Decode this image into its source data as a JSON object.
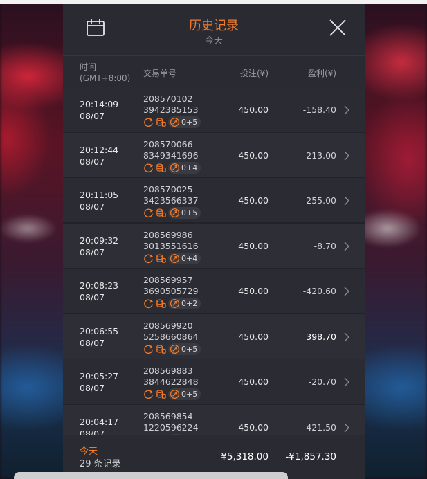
{
  "header": {
    "title": "历史记录",
    "subtitle": "今天",
    "calendar_icon": "calendar-icon",
    "close_icon": "close-icon"
  },
  "columns": {
    "time_line1": "时间",
    "time_line2": "(GMT+8:00)",
    "order": "交易单号",
    "stake": "投注(¥)",
    "profit": "盈利(¥)"
  },
  "colors": {
    "accent": "#f07a2a",
    "panel": "#26272e",
    "row": "#2b2c33",
    "text": "#cfd0d4"
  },
  "rows": [
    {
      "time": "20:14:09",
      "date": "08/07",
      "id1": "208570102",
      "id2": "3942385153",
      "combo": "0+5",
      "stake": "450.00",
      "profit": "-158.40"
    },
    {
      "time": "20:12:44",
      "date": "08/07",
      "id1": "208570066",
      "id2": "8349341696",
      "combo": "0+4",
      "stake": "450.00",
      "profit": "-213.00"
    },
    {
      "time": "20:11:05",
      "date": "08/07",
      "id1": "208570025",
      "id2": "3423566337",
      "combo": "0+5",
      "stake": "450.00",
      "profit": "-255.00"
    },
    {
      "time": "20:09:32",
      "date": "08/07",
      "id1": "208569986",
      "id2": "3013551616",
      "combo": "0+4",
      "stake": "450.00",
      "profit": "-8.70"
    },
    {
      "time": "20:08:23",
      "date": "08/07",
      "id1": "208569957",
      "id2": "3690505729",
      "combo": "0+2",
      "stake": "450.00",
      "profit": "-420.60"
    },
    {
      "time": "20:06:55",
      "date": "08/07",
      "id1": "208569920",
      "id2": "5258660864",
      "combo": "0+5",
      "stake": "450.00",
      "profit": "398.70"
    },
    {
      "time": "20:05:27",
      "date": "08/07",
      "id1": "208569883",
      "id2": "3844622848",
      "combo": "0+5",
      "stake": "450.00",
      "profit": "-20.70"
    },
    {
      "time": "20:04:17",
      "date": "08/07",
      "id1": "208569854",
      "id2": "1220596224",
      "combo": "",
      "stake": "450.00",
      "profit": "-421.50"
    }
  ],
  "footer": {
    "label": "今天",
    "count": "29 条记录",
    "total_stake": "¥5,318.00",
    "total_profit": "-¥1,857.30"
  }
}
